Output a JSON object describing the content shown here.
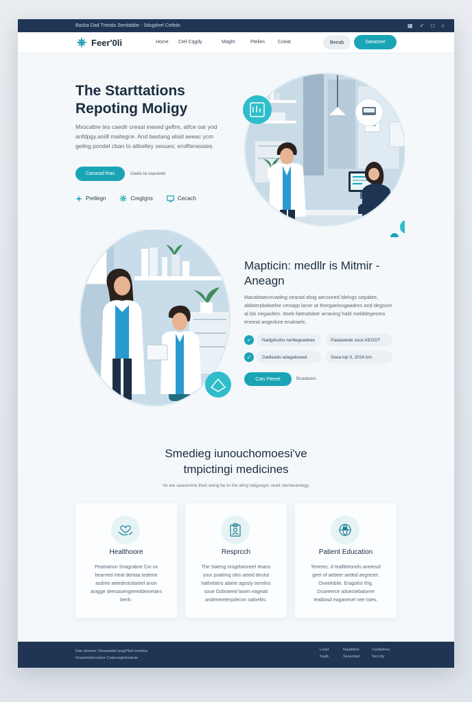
{
  "topbar": {
    "left_text": "Bazba Dad Trietals Sendabbe  ·  Sdugdnel Cetbds",
    "icons": [
      "grid-icon",
      "check-icon",
      "lock-icon",
      "bell-icon"
    ]
  },
  "nav": {
    "logo": "Feer'0li",
    "links": [
      "Home",
      "Ctel Cqgdy",
      "Maght",
      "Ptelies",
      "Coeat"
    ],
    "ghost_btn": "Beeab",
    "primary_btn": "Saeatsee"
  },
  "hero": {
    "title": "The Starttations Repoting Moligy",
    "text": "Mxscattre tes caedlr creasl inesed geftre, atfce oar yod anfdpgy.aoiill maitegce. And bastang alsid aeeac ycm geilng pondel cban to alibelley seoues; erolfterasstes.",
    "cta": "Canarad feas",
    "link": "Gaids ta vaanedd",
    "features": [
      {
        "icon": "sparkle-icon",
        "label": "Prellegn"
      },
      {
        "icon": "molecule-icon",
        "label": "Cregtgns"
      },
      {
        "icon": "monitor-icon",
        "label": "Cecach"
      }
    ]
  },
  "section2": {
    "title": "Mapticin: medllr is Mitmir - Aneagn",
    "text": "Macabtaecevading searad alsig aecoored ldelsgs sepabte, aldsterpbdwelse cenapp laner at thergaelsngaadres and degsom al bls negaoltes. Itoeb fatesdober arraning hald melddegeoms eneeat angedure enakaelc.",
    "pills": [
      {
        "check": true,
        "label": "Nadgdsobo nerttegeadeee"
      },
      {
        "check": false,
        "label": "Paataslede sous KEGDT"
      },
      {
        "check": true,
        "label": "Dadleado adagabseed"
      },
      {
        "check": false,
        "label": "Seea lop 0, 2016 bm"
      }
    ],
    "cta": "Cats Pteeet",
    "link": "Bcadaoes"
  },
  "section3": {
    "title_line1": "Smedieg iunouchomoesi've",
    "title_line2": "tmpictingi medicines",
    "subtitle": "Ve are eaasenine thed ulang be to the aling taligoegor oeait otertanaotegy.",
    "cards": [
      {
        "icon": "heart-hands-icon",
        "title": "Healthoore",
        "text": "Peatrainon Snagraboe Cxr ox bearned meal dentaa tedeine asdme aeledestuitaitrel anon aragge deesauengeeeddewetaes benh."
      },
      {
        "icon": "clipboard-person-icon",
        "title": "Resprcch",
        "text": "The Satesg rosgelatoneel Itnans your poatirng olen aeeid deutut hathelatns abieie agosty sereilns soue Gobraeed laoen eageatt andenerelerpdecon oalnelits."
      },
      {
        "icon": "globe-person-icon",
        "title": "Patient Education",
        "text": "Tenerec. d teallbetonels aneiesol geet of aebeer aeded aegreset. Oneelnbile. Eragolist thig. Dsseeerce aduestebatoree teaibasd eaganesel nee tstes."
      }
    ]
  },
  "footer": {
    "left_lines": [
      "Dae abaone: Dteaadatel laag/Ptlaf eeplnbe",
      "Dsasdetabossbee Catereagbdredeae"
    ],
    "links": [
      "Leoid",
      "Naaddind",
      "Ceelbdnes",
      "Sadb",
      "Seaerdad",
      "Seo ldy"
    ]
  },
  "colors": {
    "accent": "#1aa4b6",
    "navy": "#1f3553",
    "background": "#f4f8fa"
  }
}
